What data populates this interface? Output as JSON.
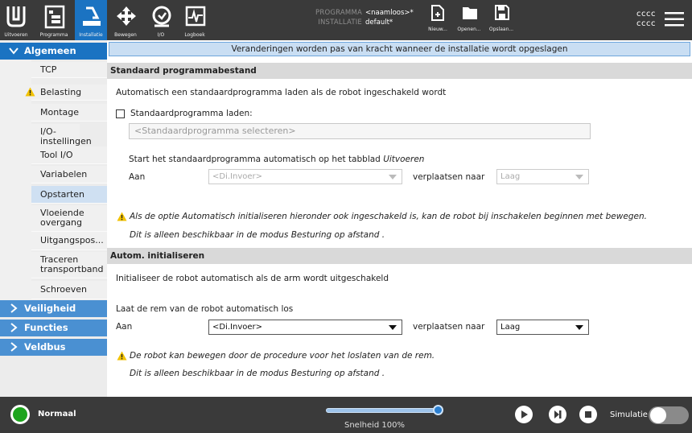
{
  "header": {
    "tabs": [
      {
        "label": "Uitvoeren",
        "icon": "ur-logo-icon"
      },
      {
        "label": "Programma",
        "icon": "program-icon"
      },
      {
        "label": "Installatie",
        "icon": "installation-icon",
        "active": true
      },
      {
        "label": "Bewegen",
        "icon": "move-icon"
      },
      {
        "label": "I/O",
        "icon": "io-icon"
      },
      {
        "label": "Logboek",
        "icon": "log-icon"
      }
    ],
    "programma_key": "PROGRAMMA",
    "programma_value": "<naamloos>*",
    "installatie_key": "INSTALLATIE",
    "installatie_value": "default*",
    "file_buttons": [
      {
        "label": "Nieuw...",
        "icon": "new-file-icon"
      },
      {
        "label": "Openen...",
        "icon": "folder-icon"
      },
      {
        "label": "Opslaan...",
        "icon": "save-icon"
      }
    ],
    "user_line1": "cccc",
    "user_line2": "cccc"
  },
  "sidebar": {
    "groups": [
      {
        "label": "Algemeen",
        "expanded": true
      },
      {
        "label": "Veiligheid",
        "expanded": false
      },
      {
        "label": "Functies",
        "expanded": false
      },
      {
        "label": "Veldbus",
        "expanded": false
      }
    ],
    "items": [
      {
        "label": "TCP"
      },
      {
        "label": "Belasting",
        "warning": true
      },
      {
        "label": "Montage"
      },
      {
        "label": "I/O-instellingen"
      },
      {
        "label": "Tool I/O"
      },
      {
        "label": "Variabelen"
      },
      {
        "label": "Opstarten",
        "selected": true
      },
      {
        "label": "Vloeiende overgang"
      },
      {
        "label": "Uitgangspos..."
      },
      {
        "label": "Traceren transportband"
      },
      {
        "label": "Schroeven"
      }
    ]
  },
  "main": {
    "banner": "Veranderingen worden pas van kracht wanneer de installatie wordt opgeslagen",
    "section1": {
      "title": "Standaard programmabestand",
      "desc": "Automatisch een standaardprogramma laden als de robot ingeschakeld wordt",
      "checkbox_label": "Standaardprogramma laden:",
      "program_placeholder": "<Standaardprogramma selecteren>",
      "autostart_text": "Start het standaardprogramma automatisch op het tabblad ",
      "autostart_tab": "Uitvoeren",
      "aan_label": "Aan",
      "input_select": "<Di.Invoer>",
      "move_to_label": "verplaatsen naar",
      "level_select": "Laag",
      "warning_line1": "Als de optie Automatisch initialiseren hieronder ook ingeschakeld is, kan de robot bij inschakelen beginnen met bewegen.",
      "warning_line2": "Dit is alleen beschikbaar in de modus Besturing op afstand ."
    },
    "section2": {
      "title": "Autom. initialiseren",
      "desc": "Initialiseer de robot automatisch als de arm wordt uitgeschakeld",
      "release_label": "Laat de rem van de robot automatisch los",
      "aan_label": "Aan",
      "input_select": "<Di.Invoer>",
      "move_to_label": "verplaatsen naar",
      "level_select": "Laag",
      "warning_line1": "De robot kan bewegen door de procedure voor het loslaten van de rem.",
      "warning_line2": "Dit is alleen beschikbaar in de modus Besturing op afstand ."
    }
  },
  "footer": {
    "status": "Normaal",
    "status_color": "#1da41d",
    "speed_label": "Snelheid 100%",
    "speed_fraction": 1.0,
    "simulation_label": "Simulatie",
    "simulation_on": false
  },
  "colors": {
    "accent": "#1b73c2",
    "topbar": "#3a3a3a",
    "warning": "#f2c200"
  }
}
